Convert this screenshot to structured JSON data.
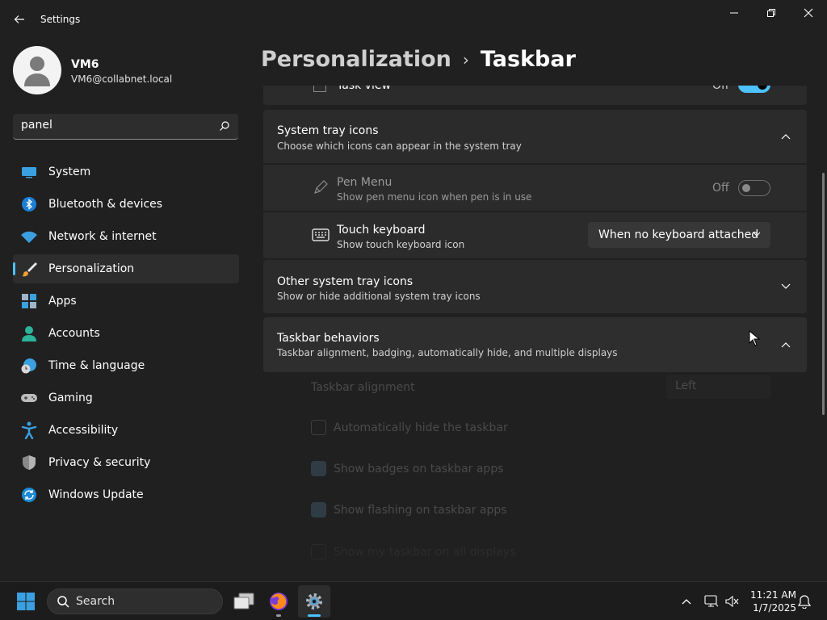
{
  "window": {
    "title": "Settings"
  },
  "profile": {
    "name": "VM6",
    "email": "VM6@collabnet.local"
  },
  "search": {
    "value": "panel"
  },
  "nav": {
    "items": [
      {
        "label": "System",
        "icon": "system-icon"
      },
      {
        "label": "Bluetooth & devices",
        "icon": "bluetooth-icon"
      },
      {
        "label": "Network & internet",
        "icon": "wifi-icon"
      },
      {
        "label": "Personalization",
        "icon": "brush-icon",
        "active": true
      },
      {
        "label": "Apps",
        "icon": "apps-icon"
      },
      {
        "label": "Accounts",
        "icon": "account-icon"
      },
      {
        "label": "Time & language",
        "icon": "clock-globe-icon"
      },
      {
        "label": "Gaming",
        "icon": "gamepad-icon"
      },
      {
        "label": "Accessibility",
        "icon": "accessibility-icon"
      },
      {
        "label": "Privacy & security",
        "icon": "shield-icon"
      },
      {
        "label": "Windows Update",
        "icon": "update-icon"
      }
    ]
  },
  "breadcrumb": {
    "parent": "Personalization",
    "separator": "›",
    "current": "Taskbar"
  },
  "task_view": {
    "label": "Task view",
    "state": "Off"
  },
  "system_tray": {
    "title": "System tray icons",
    "subtitle": "Choose which icons can appear in the system tray",
    "pen_menu": {
      "title": "Pen Menu",
      "subtitle": "Show pen menu icon when pen is in use",
      "state": "Off"
    },
    "touch_keyboard": {
      "title": "Touch keyboard",
      "subtitle": "Show touch keyboard icon",
      "value": "When no keyboard attached"
    }
  },
  "other_tray": {
    "title": "Other system tray icons",
    "subtitle": "Show or hide additional system tray icons"
  },
  "behaviors": {
    "title": "Taskbar behaviors",
    "subtitle": "Taskbar alignment, badging, automatically hide, and multiple displays",
    "alignment_label": "Taskbar alignment",
    "alignment_value": "Left",
    "auto_hide": "Automatically hide the taskbar",
    "badges": "Show badges on taskbar apps",
    "flashing": "Show flashing on taskbar apps",
    "desktop": "Show my taskbar on all displays"
  },
  "taskbar": {
    "search_label": "Search",
    "time": "11:21 AM",
    "date": "1/7/2025"
  },
  "colors": {
    "accent": "#4cc2ff",
    "background": "#202020",
    "card": "#2b2b2b"
  }
}
